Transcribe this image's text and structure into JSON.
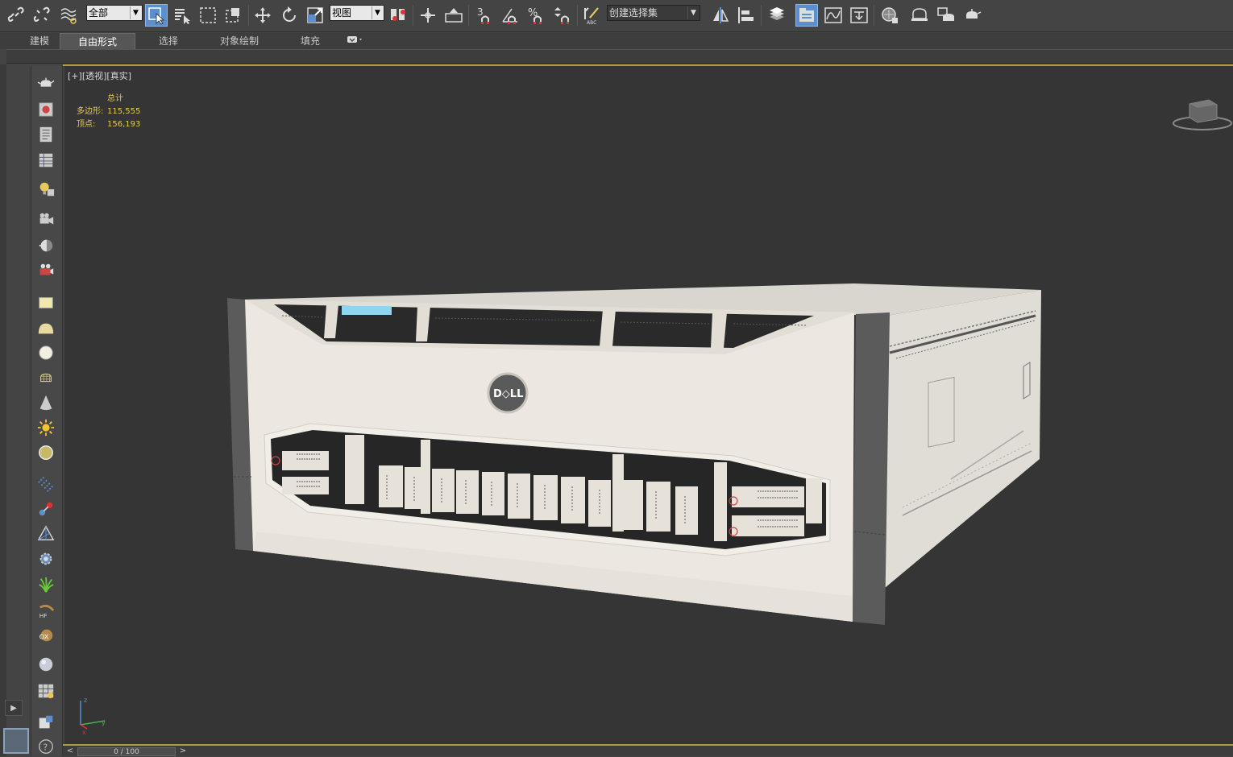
{
  "toolbar": {
    "selection_filter": "全部",
    "reference_coord": "视图",
    "named_selection_set": "创建选择集",
    "snap_3": "3",
    "icons": [
      "link-icon",
      "unlink-icon",
      "bind-spacewarp-icon",
      "select-object-icon",
      "select-by-name-icon",
      "rect-selection-icon",
      "window-crossing-icon",
      "move-icon",
      "rotate-icon",
      "scale-icon",
      "pivot-icon",
      "manipulate-icon",
      "keyboard-shortcut-icon",
      "snap-icon",
      "angle-snap-icon",
      "percent-snap-icon",
      "spinner-snap-icon",
      "edit-named-sets-icon",
      "mirror-icon",
      "align-icon",
      "layer-manager-icon",
      "scene-explorer-icon",
      "curve-editor-icon",
      "schematic-view-icon",
      "material-editor-icon",
      "render-setup-icon",
      "render-frame-icon",
      "render-icon"
    ]
  },
  "ribbon": {
    "tabs": [
      {
        "label": "建模",
        "active": false
      },
      {
        "label": "自由形式",
        "active": true
      },
      {
        "label": "选择",
        "active": false
      },
      {
        "label": "对象绘制",
        "active": false
      },
      {
        "label": "填充",
        "active": false
      }
    ],
    "extra_icon": "ribbon-options-icon"
  },
  "viewport": {
    "label_plus": "[+]",
    "label_view": "[透视]",
    "label_shading": "[真实]",
    "stats_header": "总计",
    "polygons_label": "多边形:",
    "polygons_value": "115,555",
    "vertices_label": "顶点:",
    "vertices_value": "156,193",
    "logo_text": "D◇LL",
    "axis_x": "x",
    "axis_y": "y",
    "axis_z": "z"
  },
  "command_panel_icons": [
    "teapot-icon",
    "render-frame-icon",
    "sheet-icon",
    "table-icon",
    "light-icon",
    "camera-icon",
    "half-sphere-icon",
    "dynamics-icon",
    "plane-icon",
    "hemisphere-icon",
    "sphere-icon",
    "teapot-wire-icon",
    "cone-icon",
    "sun-icon",
    "skylight-icon",
    "particle-icon",
    "bone-icon",
    "helper-icon",
    "gear-icon",
    "grass-icon",
    "hair-icon",
    "ox-icon",
    "ball-icon",
    "material-icon",
    "script-icon",
    "help-icon"
  ],
  "timeline": {
    "frame_display": "0 / 100",
    "prev_label": "<",
    "next_label": ">"
  },
  "colors": {
    "accent": "#5b8fce",
    "stats": "#e7c957",
    "viewport_bg": "#353535",
    "gold_line": "#b59a3a"
  }
}
